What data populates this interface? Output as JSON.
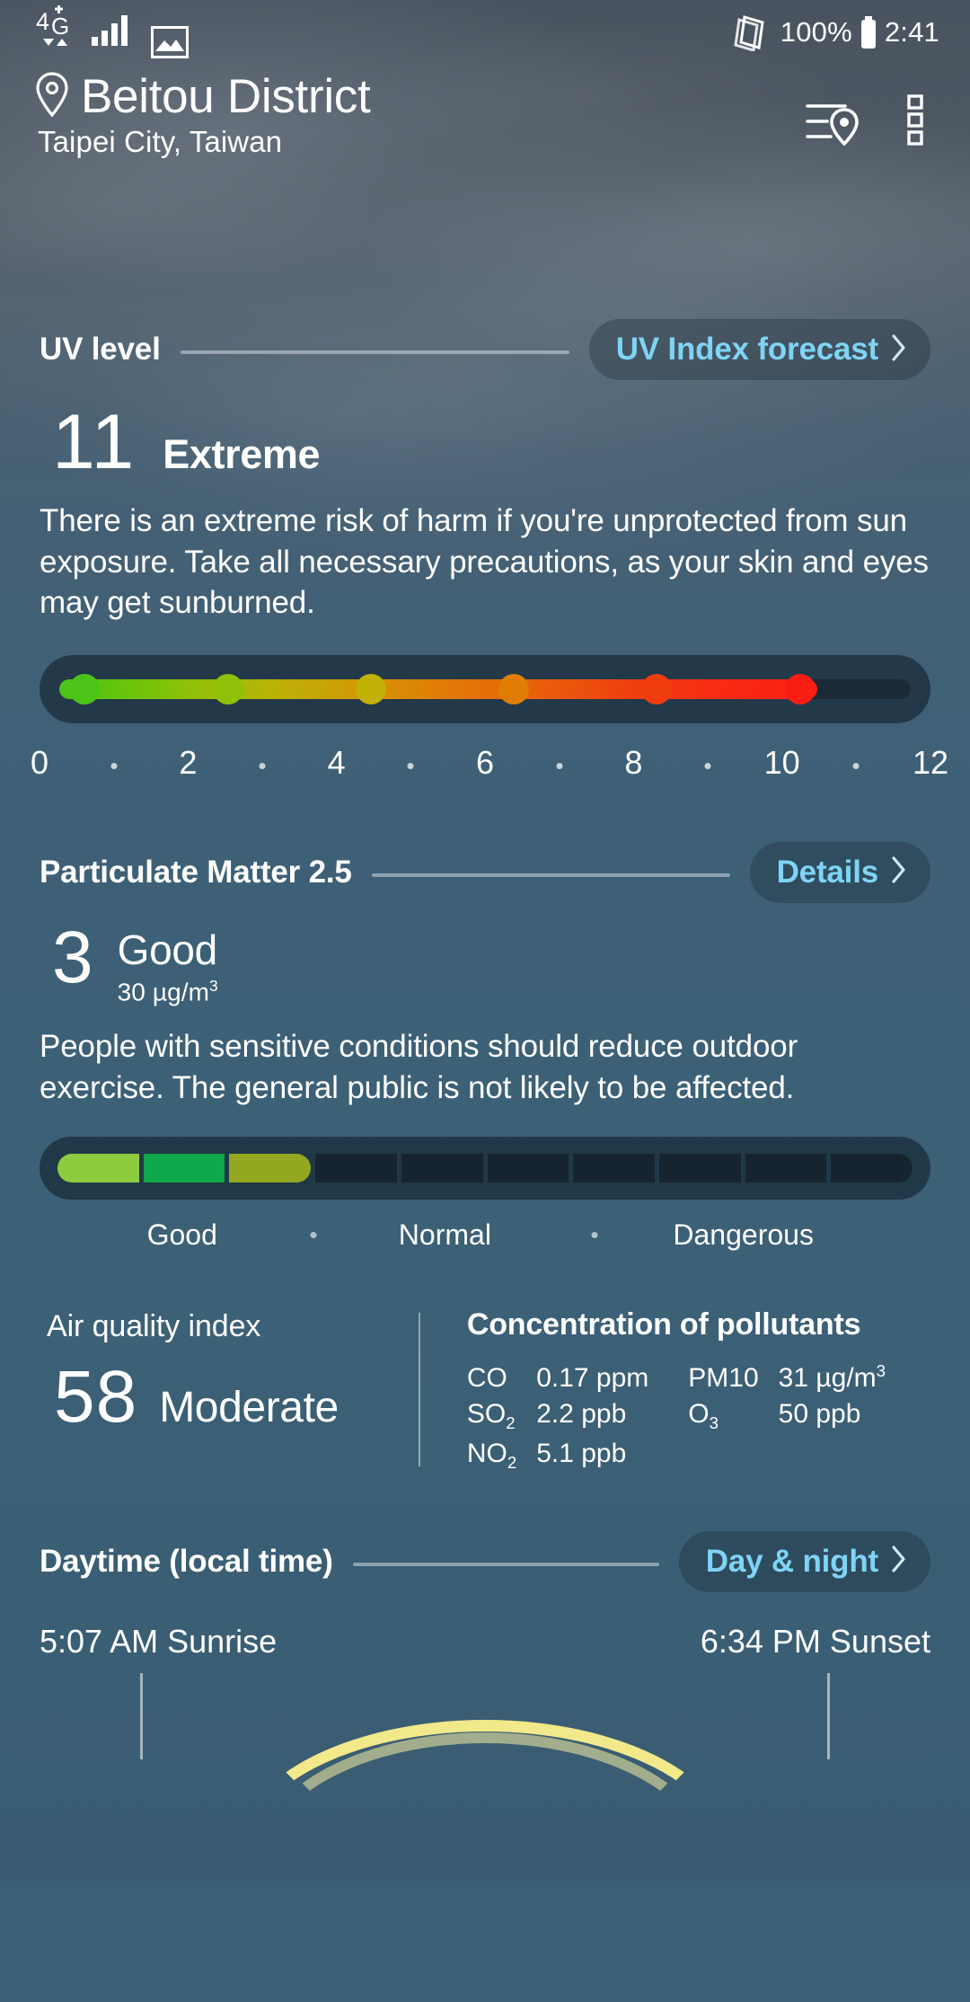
{
  "status_bar": {
    "network": "4G+",
    "battery_percent": "100%",
    "time": "2:41",
    "icons": [
      "network-4g-icon",
      "signal-bars-icon",
      "screenshot-icon",
      "nfc-icon",
      "battery-icon"
    ]
  },
  "header": {
    "location_name": "Beitou District",
    "location_sub": "Taipei City, Taiwan",
    "icons": [
      "location-pin-icon",
      "location-list-icon",
      "more-options-icon"
    ]
  },
  "uv": {
    "title": "UV level",
    "action_label": "UV Index forecast",
    "value": "11",
    "level": "Extreme",
    "description": "There is an extreme risk of harm if you're unprotected from sun exposure. Take all necessary precautions, as your skin and eyes may get sunburned.",
    "scale_labels": [
      "0",
      "2",
      "4",
      "6",
      "8",
      "10",
      "12"
    ],
    "fill_percent": 89,
    "dot_colors": [
      "#4cc417",
      "#8ec108",
      "#c1b006",
      "#e07d05",
      "#ef3d10",
      "#fa1d13"
    ]
  },
  "pm25": {
    "title": "Particulate Matter 2.5",
    "action_label": "Details",
    "value": "3",
    "level": "Good",
    "unit_value": "30 µg/m",
    "unit_exp": "3",
    "description": "People with sensitive conditions should reduce outdoor exercise. The general public is not likely to be affected.",
    "segments_total": 10,
    "segments_filled": 3,
    "segment_colors": [
      "#8dcc3f",
      "#0fa84a",
      "#93a81e"
    ],
    "scale_labels": [
      "Good",
      "Normal",
      "Dangerous"
    ]
  },
  "aqi": {
    "title": "Air quality index",
    "value": "58",
    "level": "Moderate"
  },
  "pollutants": {
    "title": "Concentration of pollutants",
    "rows": [
      {
        "k1": "CO",
        "v1": "0.17 ppm",
        "k2": "PM10",
        "v2": "31 µg/m",
        "v2_exp": "3"
      },
      {
        "k1": "SO",
        "k1_sub": "2",
        "v1": "2.2 ppb",
        "k2": "O",
        "k2_sub": "3",
        "v2": "50 ppb",
        "v2_exp": ""
      },
      {
        "k1": "NO",
        "k1_sub": "2",
        "v1": "5.1 ppb",
        "k2": "",
        "v2": "",
        "v2_exp": ""
      }
    ]
  },
  "daytime": {
    "title": "Daytime (local time)",
    "action_label": "Day & night",
    "sunrise": "5:07 AM Sunrise",
    "sunset": "6:34 PM Sunset"
  },
  "colors": {
    "accent": "#7fd4f5",
    "background": "#3c6076",
    "text": "#ffffff",
    "rule": "#d6dfe6"
  }
}
